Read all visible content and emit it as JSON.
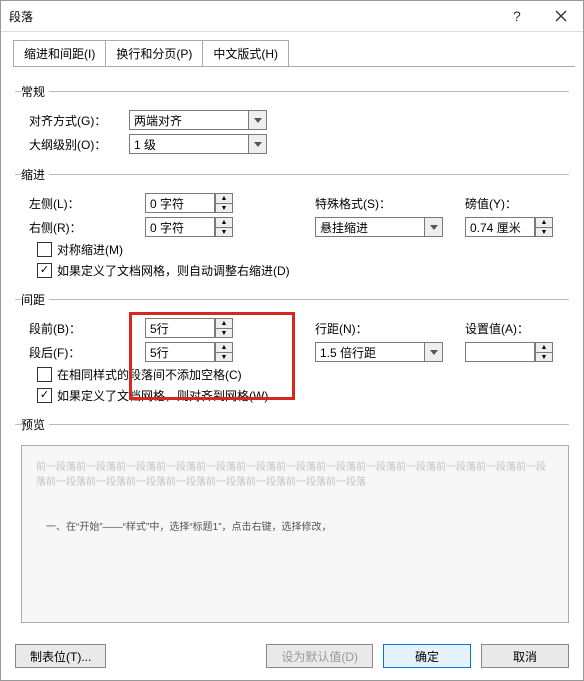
{
  "window": {
    "title": "段落"
  },
  "tabs": {
    "t1": "缩进和间距(I)",
    "t2": "换行和分页(P)",
    "t3": "中文版式(H)"
  },
  "general": {
    "legend": "常规",
    "align_label": "对齐方式(G)：",
    "align_value": "两端对齐",
    "outline_label": "大纲级别(O)：",
    "outline_value": "1 级"
  },
  "indent": {
    "legend": "缩进",
    "left_label": "左侧(L)：",
    "left_value": "0 字符",
    "right_label": "右侧(R)：",
    "right_value": "0 字符",
    "special_label": "特殊格式(S)：",
    "special_value": "悬挂缩进",
    "by_label": "磅值(Y)：",
    "by_value": "0.74 厘米",
    "mirror": "对称缩进(M)",
    "grid": "如果定义了文档网格，则自动调整右缩进(D)"
  },
  "spacing": {
    "legend": "间距",
    "before_label": "段前(B)：",
    "before_value": "5行",
    "after_label": "段后(F)：",
    "after_value": "5行",
    "line_label": "行距(N)：",
    "line_value": "1.5 倍行距",
    "at_label": "设置值(A)：",
    "at_value": "",
    "nospace": "在相同样式的段落间不添加空格(C)",
    "snap": "如果定义了文档网格，则对齐到网格(W)"
  },
  "preview": {
    "legend": "预览",
    "grey": "前一段落前一段落前一段落前一段落前一段落前一段落前一段落前一段落前一段落前一段落前一段落前一段落前一段落前一段落前一段落前一段落前一段落前一段落前一段落前一段落前一段落",
    "sample": "一、在“开始”——“样式”中，选择“标题1”，点击右键，选择修改，"
  },
  "buttons": {
    "tabs": "制表位(T)...",
    "default": "设为默认值(D)",
    "ok": "确定",
    "cancel": "取消"
  }
}
